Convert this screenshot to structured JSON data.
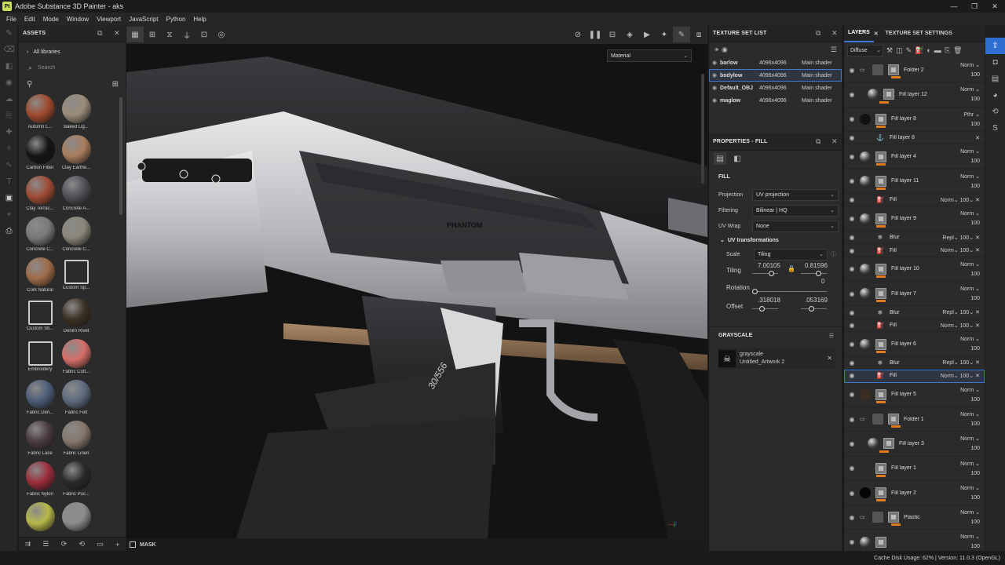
{
  "window": {
    "title": "Adobe Substance 3D Painter - aks",
    "logo": "Pt"
  },
  "menu": [
    "File",
    "Edit",
    "Mode",
    "Window",
    "Viewport",
    "JavaScript",
    "Python",
    "Help"
  ],
  "assets": {
    "title": "ASSETS",
    "library": "All libraries",
    "search_placeholder": "Search",
    "items": [
      {
        "name": "Autumn L...",
        "color": "#a04a2e"
      },
      {
        "name": "Baked Lig...",
        "color": "#9a8c78"
      },
      {
        "name": "Carbon Fiber",
        "color": "#151515"
      },
      {
        "name": "Clay Earthe...",
        "color": "#a97d5d"
      },
      {
        "name": "Clay Terrac...",
        "color": "#a04b35"
      },
      {
        "name": "Concrete A...",
        "color": "#4f5157"
      },
      {
        "name": "Concrete C...",
        "color": "#7b7a78"
      },
      {
        "name": "Concrete C...",
        "color": "#8a8679"
      },
      {
        "name": "Cork Natural",
        "color": "#a06b48"
      },
      {
        "name": "Custom Sp...",
        "color": "#333333"
      },
      {
        "name": "Custom Sti...",
        "color": "#333333"
      },
      {
        "name": "Denim Rivet",
        "color": "#3d3224"
      },
      {
        "name": "Embroidery",
        "color": "#333333"
      },
      {
        "name": "Fabric Cott...",
        "color": "#d56e68"
      },
      {
        "name": "Fabric Den...",
        "color": "#4d5d78"
      },
      {
        "name": "Fabric Felt",
        "color": "#5e6b7e"
      },
      {
        "name": "Fabric Lace",
        "color": "#4a3b3e"
      },
      {
        "name": "Fabric Linen",
        "color": "#85776c"
      },
      {
        "name": "Fabric Nylon",
        "color": "#9b2d3c"
      },
      {
        "name": "Fabric Puc...",
        "color": "#2a2a2a"
      },
      {
        "name": "",
        "color": "#b7b84a"
      },
      {
        "name": "",
        "color": "#8c8c8c"
      }
    ]
  },
  "viewport": {
    "material_mode": "Material",
    "mask_label": "MASK",
    "decal_brand": "PHANTOM",
    "mag_text": "30/556"
  },
  "texture_set_list": {
    "title": "TEXTURE SET LIST",
    "rows": [
      {
        "name": "barlow",
        "res": "4096x4096",
        "shader": "Main shader"
      },
      {
        "name": "bodylow",
        "res": "4096x4096",
        "shader": "Main shader"
      },
      {
        "name": "Default_OBJ",
        "res": "4096x4096",
        "shader": "Main shader"
      },
      {
        "name": "maglow",
        "res": "4096x4096",
        "shader": "Main shader"
      }
    ]
  },
  "properties": {
    "title": "PROPERTIES - FILL",
    "section": "FILL",
    "projection_label": "Projection",
    "projection": "UV projection",
    "filtering_label": "Filtering",
    "filtering": "Bilinear | HQ",
    "uvwrap_label": "UV Wrap",
    "uvwrap": "None",
    "uvtrans": "UV transformations",
    "scale_label": "Scale",
    "scale": "Tiling",
    "tiling_label": "Tiling",
    "tiling_x": "7.00105",
    "tiling_y": "0.81596",
    "rotation_label": "Rotation",
    "rotation": "0",
    "offset_label": "Offset",
    "offset_x": ".318018",
    "offset_y": ".053169",
    "grayscale_title": "GRAYSCALE",
    "gs_name": "grayscale",
    "gs_file": "Untitled_Artwork 2"
  },
  "layers": {
    "tab1": "LAYERS",
    "tab2": "TEXTURE SET SETTINGS",
    "channel": "Diffuse",
    "rows": [
      {
        "type": "folder",
        "name": "Folder 2",
        "blend": "Norm",
        "op": "100",
        "bar": true
      },
      {
        "type": "layer",
        "name": "Fill layer 12",
        "blend": "Norm",
        "op": "100",
        "bar": true,
        "indent": true
      },
      {
        "type": "layer",
        "name": "Fill layer 8",
        "blend": "Pthr",
        "op": "100",
        "bar": true,
        "thumb": "#111"
      },
      {
        "type": "child",
        "name": "Fill layer 8",
        "icon": "anchor"
      },
      {
        "type": "layer",
        "name": "Fill layer 4",
        "blend": "Norm",
        "op": "100",
        "bar": true
      },
      {
        "type": "layer",
        "name": "Fill layer 11",
        "blend": "Norm",
        "op": "100",
        "bar": true
      },
      {
        "type": "child",
        "name": "Fill",
        "blend": "Norm",
        "op": "100",
        "icon": "fill"
      },
      {
        "type": "layer",
        "name": "Fill layer 9",
        "blend": "Norm",
        "op": "100",
        "bar": true
      },
      {
        "type": "child",
        "name": "Blur",
        "blend": "Repl",
        "op": "100",
        "icon": "blur"
      },
      {
        "type": "child",
        "name": "Fill",
        "blend": "Norm",
        "op": "100",
        "icon": "fill"
      },
      {
        "type": "layer",
        "name": "Fill layer 10",
        "blend": "Norm",
        "op": "100",
        "bar": true
      },
      {
        "type": "layer",
        "name": "Fill layer 7",
        "blend": "Norm",
        "op": "100",
        "bar": true
      },
      {
        "type": "child",
        "name": "Blur",
        "blend": "Repl",
        "op": "100",
        "icon": "blur"
      },
      {
        "type": "child",
        "name": "Fill",
        "blend": "Norm",
        "op": "100",
        "icon": "fill"
      },
      {
        "type": "layer",
        "name": "Fill layer 6",
        "blend": "Norm",
        "op": "100",
        "bar": true
      },
      {
        "type": "child",
        "name": "Blur",
        "blend": "Repl",
        "op": "100",
        "icon": "blur"
      },
      {
        "type": "child",
        "name": "Fill",
        "blend": "Norm",
        "op": "100",
        "icon": "fill",
        "selected": true
      },
      {
        "type": "layer",
        "name": "Fill layer 5",
        "blend": "Norm",
        "op": "100",
        "bar": true,
        "thumb": "#3a2e22"
      },
      {
        "type": "folder",
        "name": "Folder 1",
        "blend": "Norm",
        "op": "100",
        "bar": true
      },
      {
        "type": "layer",
        "name": "Fill layer 3",
        "blend": "Norm",
        "op": "100",
        "bar": true,
        "indent": true
      },
      {
        "type": "layer",
        "name": "Fill layer 1",
        "blend": "Norm",
        "op": "100",
        "bar": true,
        "thumb": "#2a2a2a"
      },
      {
        "type": "layer",
        "name": "Fill layer 2",
        "blend": "Norm",
        "op": "100",
        "bar": true,
        "thumb": "#050505"
      },
      {
        "type": "folder",
        "name": "Plastic",
        "blend": "Norm",
        "op": "100",
        "bar": true
      },
      {
        "type": "layer",
        "name": "",
        "blend": "Norm",
        "op": "100",
        "bar": false
      }
    ]
  },
  "status": "Cache Disk Usage:    62% | Version: 11.0.3 (OpenGL)",
  "colors": {
    "accent": "#3a78d4",
    "orange": "#e07a1f"
  }
}
